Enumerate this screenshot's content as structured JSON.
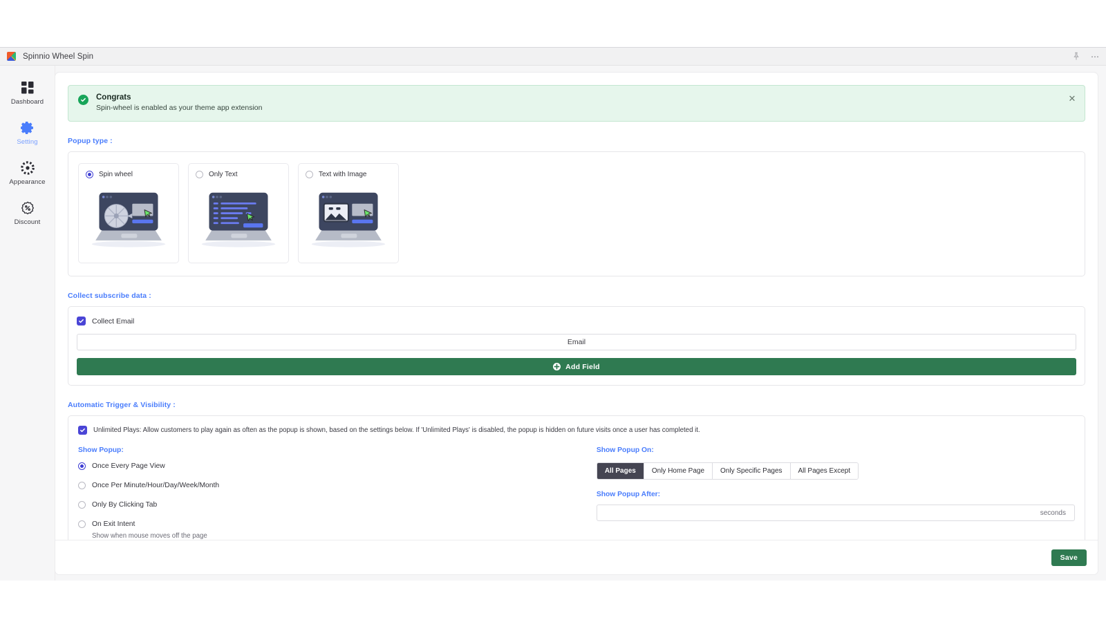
{
  "window": {
    "title": "Spinnio Wheel Spin",
    "logo_icon": "app-logo-icon",
    "pin_icon": "pin-icon",
    "overflow_icon": "more-options-icon"
  },
  "sidebar": {
    "items": [
      {
        "label": "Dashboard",
        "icon": "dashboard-grid-icon",
        "active": false
      },
      {
        "label": "Setting",
        "icon": "gear-icon",
        "active": true
      },
      {
        "label": "Appearance",
        "icon": "appearance-dots-icon",
        "active": false
      },
      {
        "label": "Discount",
        "icon": "discount-badge-icon",
        "active": false
      }
    ]
  },
  "banner": {
    "icon": "success-check-icon",
    "title": "Congrats",
    "subtitle": "Spin-wheel is enabled as your theme app extension",
    "close_icon": "close-icon",
    "accent_color": "#17a559",
    "background_color": "#e6f6ec"
  },
  "popup_type": {
    "section_label": "Popup type :",
    "options": [
      {
        "label": "Spin wheel",
        "selected": true,
        "illustration": "laptop-spin-wheel-illustration"
      },
      {
        "label": "Only Text",
        "selected": false,
        "illustration": "laptop-only-text-illustration"
      },
      {
        "label": "Text with Image",
        "selected": false,
        "illustration": "laptop-text-with-image-illustration"
      }
    ]
  },
  "collect": {
    "section_label": "Collect subscribe data :",
    "collect_email_label": "Collect Email",
    "collect_email_checked": true,
    "field_value": "Email",
    "add_field_label": "Add Field",
    "add_field_icon": "plus-circle-icon",
    "button_color": "#2f7a51"
  },
  "trigger": {
    "section_label": "Automatic Trigger & Visibility :",
    "unlimited_plays_checked": true,
    "unlimited_plays_text": "Unlimited Plays: Allow customers to play again as often as the popup is shown, based on the settings below. If 'Unlimited Plays' is disabled, the popup is hidden on future visits once a user has completed it.",
    "show_popup_label": "Show Popup:",
    "show_popup_options": [
      {
        "label": "Once Every Page View",
        "selected": true,
        "sub": ""
      },
      {
        "label": "Once Per Minute/Hour/Day/Week/Month",
        "selected": false,
        "sub": ""
      },
      {
        "label": "Only By Clicking Tab",
        "selected": false,
        "sub": ""
      },
      {
        "label": "On Exit Intent",
        "selected": false,
        "sub": "Show when mouse moves off the page"
      }
    ],
    "show_popup_on_label": "Show Popup On:",
    "show_popup_on_options": [
      {
        "label": "All Pages",
        "active": true
      },
      {
        "label": "Only Home Page",
        "active": false
      },
      {
        "label": "Only Specific Pages",
        "active": false
      },
      {
        "label": "All Pages Except",
        "active": false
      }
    ],
    "show_popup_after_label": "Show Popup After:",
    "show_popup_after_value": "",
    "show_popup_after_unit": "seconds"
  },
  "footer": {
    "save_label": "Save"
  },
  "colors": {
    "accent_blue": "#4a7dfc",
    "radio_purple": "#3d3dd4",
    "checkbox_purple": "#4a45d6",
    "green": "#2f7a51",
    "segment_active": "#454552"
  }
}
